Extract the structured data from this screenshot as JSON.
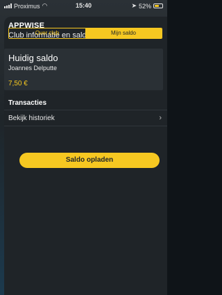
{
  "statusbar": {
    "carrier": "Proximus",
    "time": "15:40",
    "battery_text": "52%",
    "battery_level": 0.52
  },
  "header": {
    "brand": "APPWISE",
    "subtitle": "Club informatie en saldo",
    "close_symbol": "×"
  },
  "tabs": [
    {
      "label": "Over club",
      "active": false
    },
    {
      "label": "Mijn saldo",
      "active": true
    }
  ],
  "balance": {
    "title": "Huidig saldo",
    "name": "Joannes Delputte",
    "amount": "7,50 €"
  },
  "transactions": {
    "title": "Transacties",
    "history_label": "Bekijk historiek"
  },
  "topup_button": "Saldo opladen",
  "colors": {
    "accent": "#f6c821",
    "sheet": "#1f2428",
    "card": "#2a3035"
  }
}
